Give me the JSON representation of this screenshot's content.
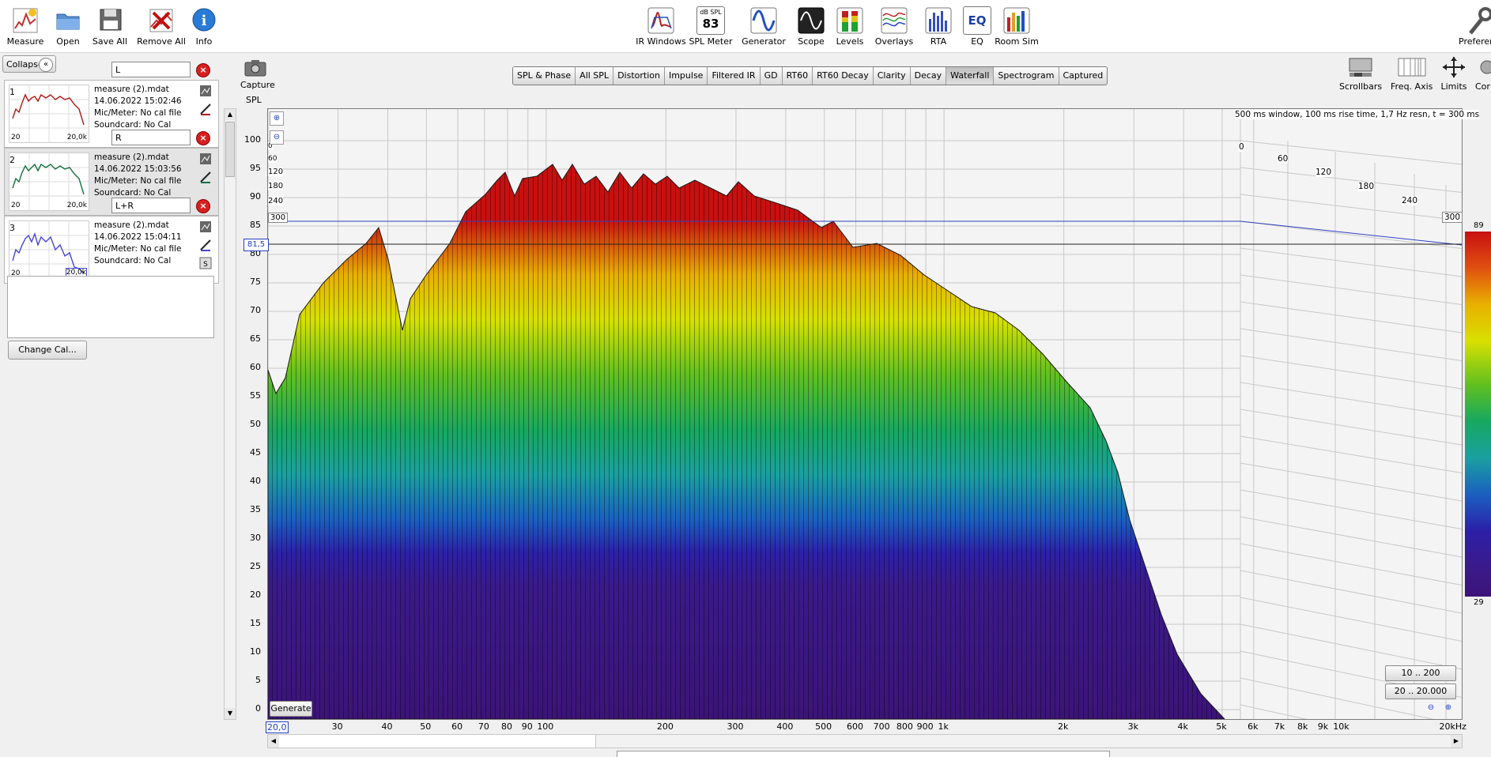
{
  "toolbar": {
    "left": [
      {
        "label": "Measure",
        "icon": "microphone-icon"
      },
      {
        "label": "Open",
        "icon": "folder-icon"
      },
      {
        "label": "Save All",
        "icon": "floppy-icon"
      },
      {
        "label": "Remove All",
        "icon": "remove-all-icon"
      },
      {
        "label": "Info",
        "icon": "info-icon"
      }
    ],
    "center": [
      {
        "label": "IR Windows",
        "icon": "ir-windows-icon"
      },
      {
        "label": "SPL Meter",
        "icon": "spl-meter-icon",
        "badge_top": "dB SPL",
        "badge_value": "83"
      },
      {
        "label": "Generator",
        "icon": "generator-icon"
      },
      {
        "label": "Scope",
        "icon": "scope-icon"
      },
      {
        "label": "Levels",
        "icon": "levels-icon"
      },
      {
        "label": "Overlays",
        "icon": "overlays-icon"
      },
      {
        "label": "RTA",
        "icon": "rta-icon"
      },
      {
        "label": "EQ",
        "icon": "eq-icon",
        "badge_value": "EQ"
      },
      {
        "label": "Room Sim",
        "icon": "room-sim-icon"
      }
    ],
    "right_label": "Preferen"
  },
  "panel": {
    "collapse_label": "Collapse",
    "measurements": [
      {
        "num": "1",
        "name": "L",
        "file": "measure (2).mdat",
        "date": "14.06.2022 15:02:46",
        "mic": "Mic/Meter: No cal file",
        "sound": "Soundcard: No Cal",
        "color": "#b01818",
        "thumb_left": "20",
        "thumb_right": "20,0k"
      },
      {
        "num": "2",
        "name": "R",
        "file": "measure (2).mdat",
        "date": "14.06.2022 15:03:56",
        "mic": "Mic/Meter: No cal file",
        "sound": "Soundcard: No Cal",
        "color": "#157040",
        "thumb_left": "20",
        "thumb_right": "20,0k"
      },
      {
        "num": "3",
        "name": "L+R",
        "file": "measure (2).mdat",
        "date": "14.06.2022 15:04:11",
        "mic": "Mic/Meter: No cal file",
        "sound": "Soundcard: No Cal",
        "color": "#4646d8",
        "thumb_left": "20",
        "thumb_right": "20,0k"
      }
    ],
    "change_cal": "Change Cal..."
  },
  "capture_label": "Capture",
  "right_tools": [
    {
      "label": "Scrollbars",
      "icon": "scrollbars-icon"
    },
    {
      "label": "Freq. Axis",
      "icon": "freq-axis-icon"
    },
    {
      "label": "Limits",
      "icon": "limits-icon"
    },
    {
      "label": "Cor",
      "icon": "controls-icon"
    }
  ],
  "tabs": [
    "SPL & Phase",
    "All SPL",
    "Distortion",
    "Impulse",
    "Filtered IR",
    "GD",
    "RT60",
    "RT60 Decay",
    "Clarity",
    "Decay",
    "Waterfall",
    "Spectrogram",
    "Captured"
  ],
  "active_tab": "Waterfall",
  "graph": {
    "y_axis_title": "SPL",
    "y_ticks": [
      "100",
      "95",
      "90",
      "85",
      "80",
      "75",
      "70",
      "65",
      "60",
      "55",
      "50",
      "45",
      "40",
      "35",
      "30",
      "25",
      "20",
      "15",
      "10",
      "5",
      "0"
    ],
    "x_ticks": [
      "20,0",
      "30",
      "40",
      "50",
      "60",
      "70",
      "80",
      "90",
      "100",
      "200",
      "300",
      "400",
      "500",
      "600",
      "700",
      "800",
      "900",
      "1k",
      "2k",
      "3k",
      "4k",
      "5k",
      "6k",
      "7k",
      "8k",
      "9k",
      "10k",
      "20kHz"
    ],
    "cursor_value": "81,5",
    "window_info": "500 ms window, 100 ms rise time,  1,7 Hz resn, t = 300 ms",
    "time_ticks": [
      "0",
      "60",
      "120",
      "180",
      "240",
      "300"
    ],
    "left_time_ticks": [
      "0",
      "60",
      "120",
      "180",
      "240",
      "300"
    ],
    "generate": "Generate",
    "range_a": "10 .. 200",
    "range_b": "20 .. 20.000",
    "colorbar_max": "89",
    "colorbar_min": "29"
  }
}
